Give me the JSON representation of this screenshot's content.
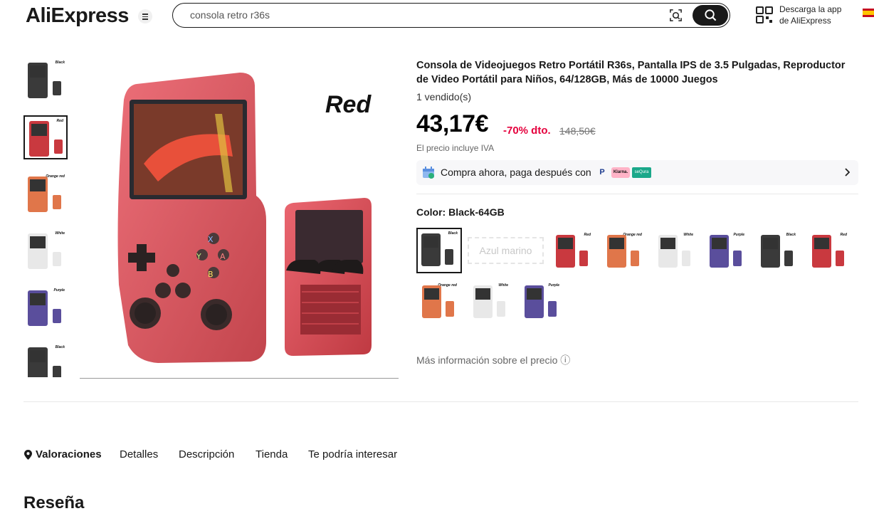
{
  "header": {
    "logo": "AliExpress",
    "search_value": "consola retro r36s",
    "app_line1": "Descarga la app",
    "app_line2": "de AliExpress"
  },
  "thumbnails": [
    {
      "label": "Black",
      "color": "#3a3a3a"
    },
    {
      "label": "Red",
      "color": "#c9393f",
      "selected": true
    },
    {
      "label": "Orange red",
      "color": "#e0764a"
    },
    {
      "label": "White",
      "color": "#e8e8e8"
    },
    {
      "label": "Purple",
      "color": "#5a4e9c"
    },
    {
      "label": "Black",
      "color": "#3a3a3a"
    }
  ],
  "main_image": {
    "label": "Red",
    "color": "#d23c43"
  },
  "product": {
    "title": "Consola de Videojuegos Retro Portátil R36s, Pantalla IPS de 3.5 Pulgadas, Reproductor de Video Portátil para Niños, 64/128GB, Más de 10000 Juegos",
    "sold": "1 vendido(s)",
    "price": "43,17€",
    "discount": "-70% dto.",
    "original_price": "148,50€",
    "vat_note": "El precio incluye IVA",
    "bnpl_text": "Compra ahora, paga después con",
    "klarna": "Klarna.",
    "sequra": "seQura",
    "color_label": "Color: Black-64GB",
    "text_option": "Azul marino",
    "more_info": "Más información sobre el precio ⓘ"
  },
  "swatches": [
    {
      "label": "Black",
      "color": "#3a3a3a",
      "selected": true
    },
    {
      "label": "Red",
      "color": "#c9393f"
    },
    {
      "label": "Orange red",
      "color": "#e0764a"
    },
    {
      "label": "White",
      "color": "#e8e8e8"
    },
    {
      "label": "Purple",
      "color": "#5a4e9c"
    },
    {
      "label": "Black",
      "color": "#3a3a3a"
    },
    {
      "label": "Red",
      "color": "#c9393f"
    },
    {
      "label": "Orange red",
      "color": "#e0764a"
    },
    {
      "label": "White",
      "color": "#e8e8e8"
    },
    {
      "label": "Purple",
      "color": "#5a4e9c"
    }
  ],
  "tabs": [
    "Valoraciones",
    "Detalles",
    "Descripción",
    "Tienda",
    "Te podría interesar"
  ],
  "review_heading": "Reseña"
}
